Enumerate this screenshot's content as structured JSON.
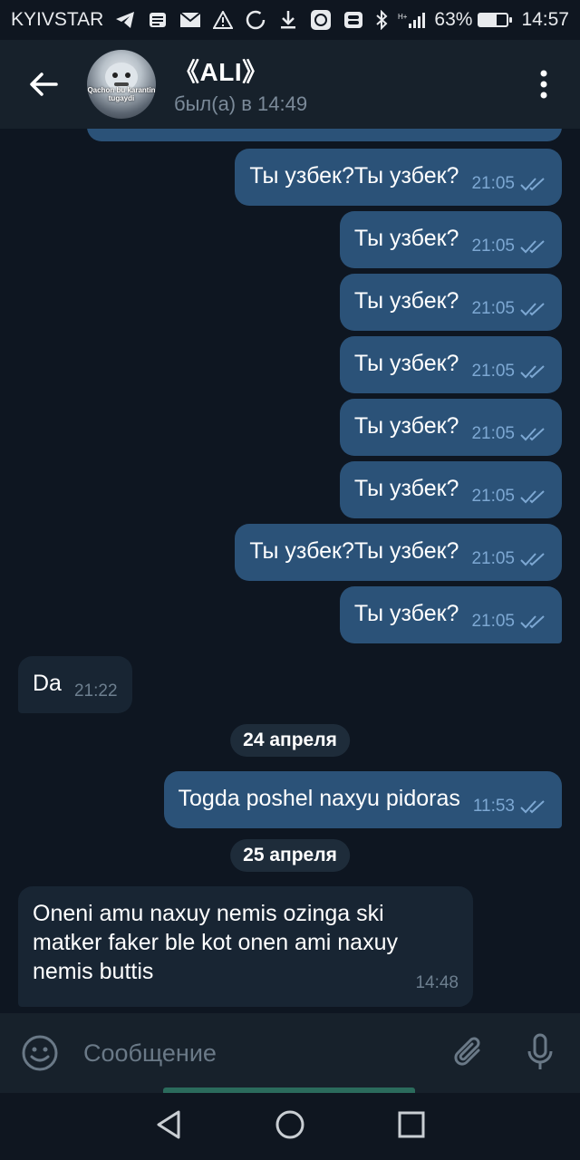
{
  "status_bar": {
    "carrier": "KYIVSTAR",
    "battery_percent": "63%",
    "battery_level": 0.63,
    "time": "14:57",
    "icons": [
      "telegram-icon",
      "message-icon",
      "mail-icon",
      "warning-icon",
      "circle-icon",
      "download-icon",
      "app-icon",
      "toggle-icon",
      "bluetooth-icon",
      "signal-icon",
      "battery-icon"
    ]
  },
  "header": {
    "back_icon": "arrow-left-icon",
    "avatar_caption": "Qachon bu karantin tugaydi",
    "chat_name": "《ALI》",
    "status": "был(а) в 14:49",
    "menu_icon": "more-vert-icon"
  },
  "messages": [
    {
      "text": "Ты узбек?Ты узбек?",
      "time": "21:05"
    },
    {
      "text": "Ты узбек?",
      "time": "21:05"
    },
    {
      "text": "Ты узбек?",
      "time": "21:05"
    },
    {
      "text": "Ты узбек?",
      "time": "21:05"
    },
    {
      "text": "Ты узбек?",
      "time": "21:05"
    },
    {
      "text": "Ты узбек?",
      "time": "21:05"
    },
    {
      "text": "Ты узбек?Ты узбек?",
      "time": "21:05"
    },
    {
      "text": "Ты узбек?",
      "time": "21:05"
    },
    {
      "text": "Da",
      "time": "21:22"
    },
    {
      "date": "24 апреля"
    },
    {
      "text": "Togda poshel naxyu pidoras",
      "time": "11:53"
    },
    {
      "date": "25 апреля"
    },
    {
      "text": "Oneni amu naxuy nemis  ozinga ski matker faker ble kot onen ami naxuy nemis buttis",
      "time": "14:48"
    }
  ],
  "composer": {
    "placeholder": "Сообщение",
    "emoji_icon": "emoji-icon",
    "attach_icon": "paperclip-icon",
    "mic_icon": "microphone-icon"
  },
  "nav": {
    "back": "nav-back-icon",
    "home": "nav-home-icon",
    "recents": "nav-recents-icon"
  },
  "colors": {
    "background": "#0e1621",
    "header": "#17212b",
    "outgoing_bubble": "#2b5278",
    "incoming_bubble": "#182533",
    "read_check": "#7da8d3"
  }
}
